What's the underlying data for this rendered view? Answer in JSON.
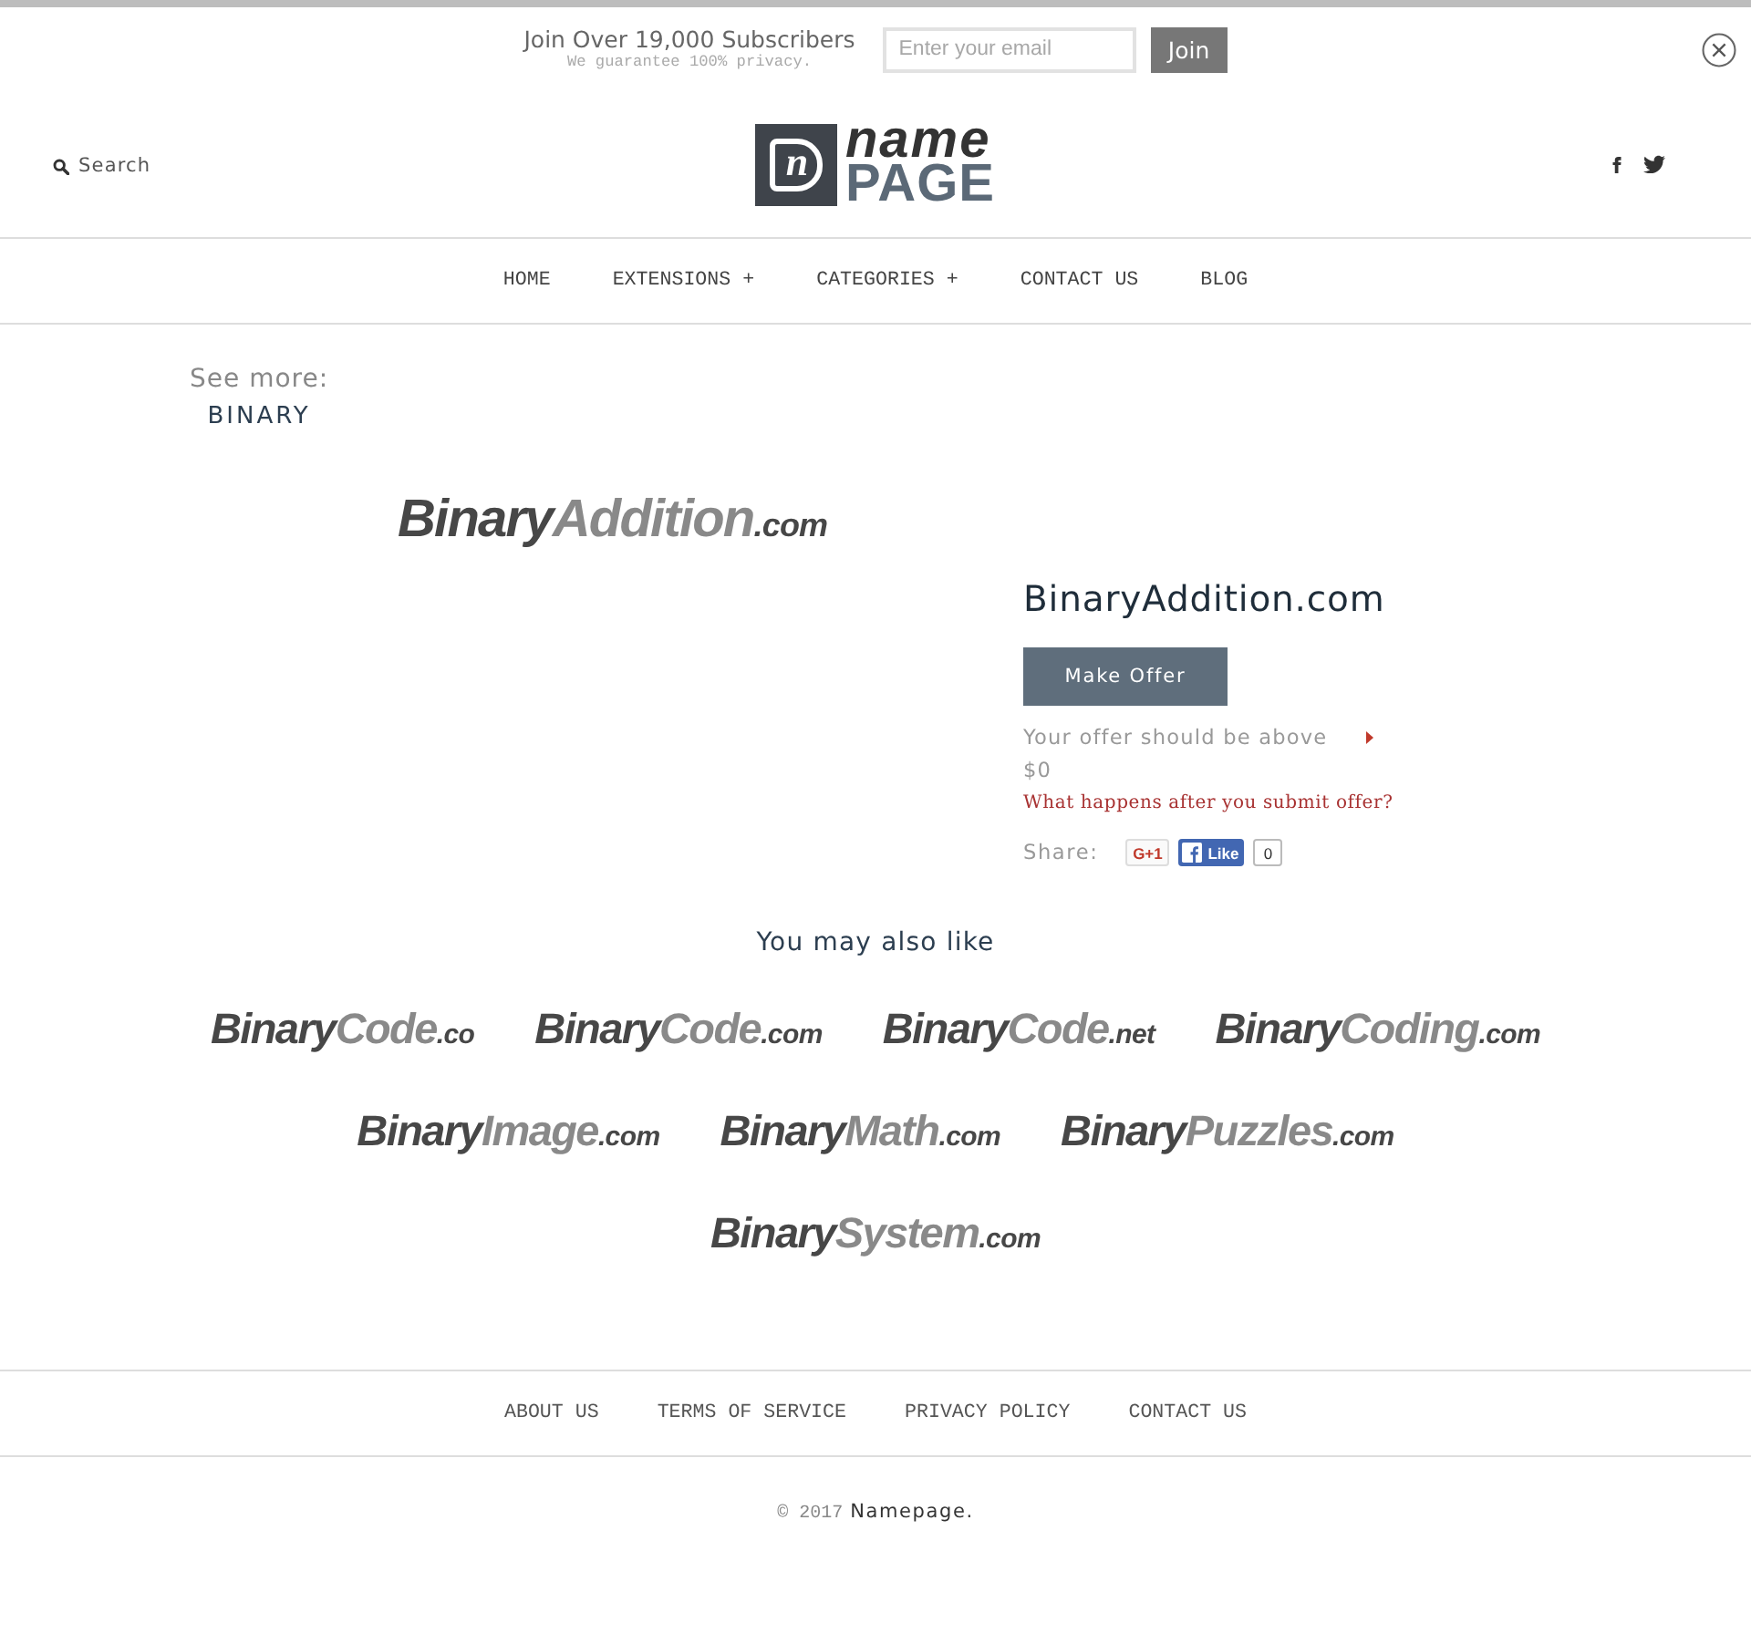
{
  "signup": {
    "title": "Join Over 19,000 Subscribers",
    "subtitle": "We guarantee 100% privacy.",
    "email_placeholder": "Enter your email",
    "button": "Join"
  },
  "header": {
    "search": "Search",
    "logo": {
      "mark": "n",
      "top": "name",
      "bottom": "PAGE"
    }
  },
  "nav": [
    "HOME",
    "EXTENSIONS +",
    "CATEGORIES +",
    "CONTACT US",
    "BLOG"
  ],
  "see_more": {
    "label": "See more:",
    "tag": "BINARY"
  },
  "domain": {
    "logo": {
      "prefix": "Binary",
      "name": "Addition",
      "tld": ".com"
    },
    "title": "BinaryAddition.com",
    "button": "Make Offer",
    "offer_note": "Your offer should be above",
    "min_offer": "$0",
    "help_link": "What happens after you submit offer?",
    "share_label": "Share:",
    "gplus": "G+1",
    "fb_like": "Like",
    "fb_count": "0"
  },
  "related": {
    "title": "You may also like",
    "rows": [
      [
        {
          "prefix": "Binary",
          "name": "Code",
          "tld": ".co"
        },
        {
          "prefix": "Binary",
          "name": "Code",
          "tld": ".com"
        },
        {
          "prefix": "Binary",
          "name": "Code",
          "tld": ".net"
        },
        {
          "prefix": "Binary",
          "name": "Coding",
          "tld": ".com"
        }
      ],
      [
        {
          "prefix": "Binary",
          "name": "Image",
          "tld": ".com"
        },
        {
          "prefix": "Binary",
          "name": "Math",
          "tld": ".com"
        },
        {
          "prefix": "Binary",
          "name": "Puzzles",
          "tld": ".com"
        }
      ],
      [
        {
          "prefix": "Binary",
          "name": "System",
          "tld": ".com"
        }
      ]
    ]
  },
  "footer": {
    "links": [
      "ABOUT US",
      "TERMS OF SERVICE",
      "PRIVACY POLICY",
      "CONTACT US"
    ],
    "copyright": "© 2017",
    "brand": "Namepage."
  }
}
